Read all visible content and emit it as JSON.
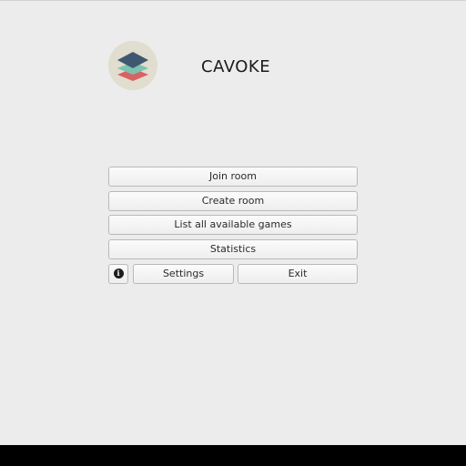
{
  "app": {
    "title": "CAVOKE",
    "logo_icon": "stacked-layers-icon",
    "colors": {
      "logo_bg": "#e1ddcf",
      "layer_top": "#3f5872",
      "layer_middle": "#7bc3ae",
      "layer_bottom": "#d96262"
    }
  },
  "menu": {
    "join_room": "Join room",
    "create_room": "Create room",
    "list_games": "List all available games",
    "statistics": "Statistics",
    "info_icon": "info-icon",
    "settings": "Settings",
    "exit": "Exit"
  }
}
